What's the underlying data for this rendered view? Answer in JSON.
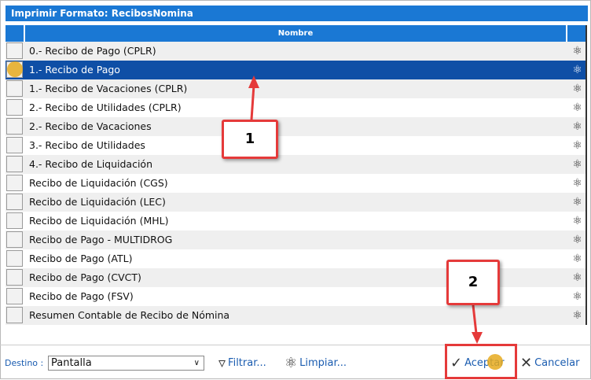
{
  "title": "Imprimir Formato: RecibosNomina",
  "header": {
    "column": "Nombre"
  },
  "rows": [
    {
      "label": "0.- Recibo de Pago (CPLR)",
      "selected": false
    },
    {
      "label": "1.- Recibo de Pago",
      "selected": true
    },
    {
      "label": "1.- Recibo de Vacaciones (CPLR)",
      "selected": false
    },
    {
      "label": "2.- Recibo de Utilidades (CPLR)",
      "selected": false
    },
    {
      "label": "2.- Recibo de Vacaciones",
      "selected": false
    },
    {
      "label": "3.- Recibo de Utilidades",
      "selected": false
    },
    {
      "label": "4.- Recibo de Liquidación",
      "selected": false
    },
    {
      "label": "Recibo de Liquidación (CGS)",
      "selected": false
    },
    {
      "label": "Recibo de Liquidación (LEC)",
      "selected": false
    },
    {
      "label": "Recibo de Liquidación (MHL)",
      "selected": false
    },
    {
      "label": "Recibo de Pago - MULTIDROG",
      "selected": false
    },
    {
      "label": "Recibo de Pago (ATL)",
      "selected": false
    },
    {
      "label": "Recibo de Pago (CVCT)",
      "selected": false
    },
    {
      "label": "Recibo de Pago (FSV)",
      "selected": false
    },
    {
      "label": "Resumen Contable de Recibo de Nómina",
      "selected": false
    }
  ],
  "footer": {
    "destino_label": "Destino :",
    "destino_value": "Pantalla",
    "filtrar": "Filtrar...",
    "limpiar": "Limpiar...",
    "aceptar": "Aceptar",
    "cancelar": "Cancelar"
  },
  "callouts": {
    "one": "1",
    "two": "2"
  },
  "colors": {
    "accent": "#1a78d4",
    "selected": "#0f4fa6",
    "annotation": "#e53a3a"
  }
}
